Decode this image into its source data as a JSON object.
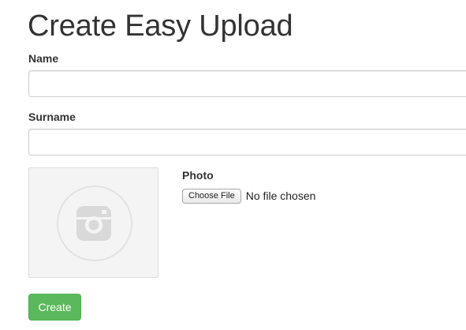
{
  "page": {
    "title": "Create Easy Upload"
  },
  "form": {
    "name": {
      "label": "Name",
      "value": ""
    },
    "surname": {
      "label": "Surname",
      "value": ""
    },
    "photo": {
      "label": "Photo",
      "placeholder_icon": "camera-icon",
      "choose_button_label": "Choose File",
      "status_text": "No file chosen"
    },
    "submit_label": "Create"
  },
  "colors": {
    "primary_success": "#5cb85c",
    "text": "#333333",
    "input_border": "#cccccc",
    "photo_placeholder_bg": "#f4f4f4",
    "icon_gray": "#d9d9d9"
  }
}
